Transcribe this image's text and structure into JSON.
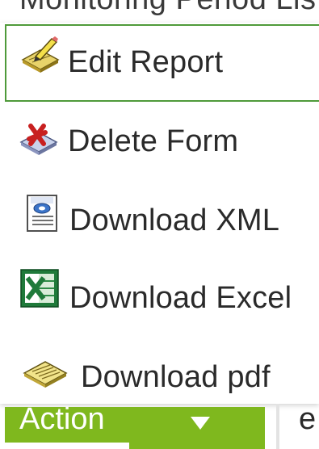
{
  "header": {
    "clipped_text": "Monitoring Period Lis"
  },
  "menu": {
    "items": [
      {
        "label": "Edit Report",
        "icon": "edit-report-icon"
      },
      {
        "label": "Delete Form",
        "icon": "delete-form-icon"
      },
      {
        "label": "Download XML",
        "icon": "xml-document-icon"
      },
      {
        "label": "Download Excel",
        "icon": "excel-icon"
      },
      {
        "label": "Download pdf",
        "icon": "pdf-document-icon"
      }
    ]
  },
  "action_bar": {
    "label": "Action",
    "caret_icon": "caret-down-icon"
  },
  "side": {
    "letter": "e"
  },
  "colors": {
    "accent_green": "#7fb81e",
    "active_border": "#4f9a3a",
    "text": "#2a2a2a"
  }
}
